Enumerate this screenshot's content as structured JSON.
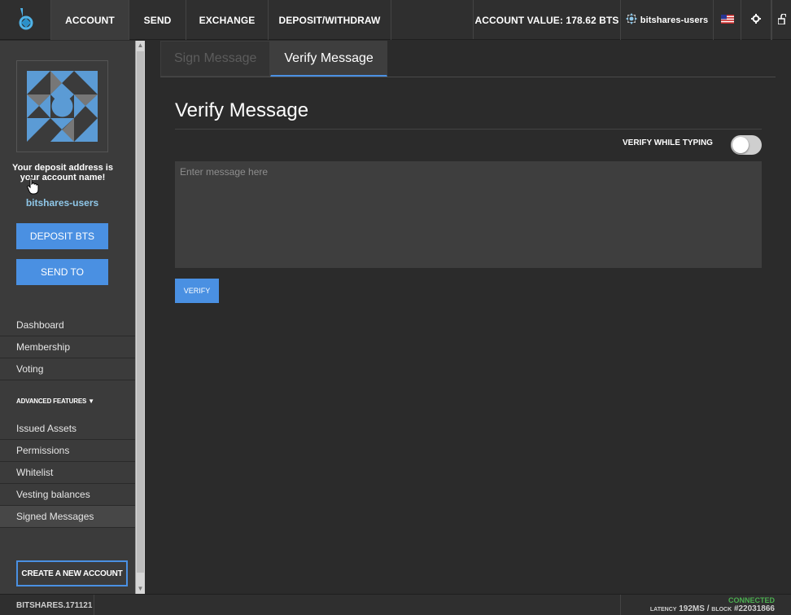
{
  "topbar": {
    "nav": {
      "account": "ACCOUNT",
      "send": "SEND",
      "exchange": "EXCHANGE",
      "deposit_withdraw": "DEPOSIT/WITHDRAW"
    },
    "account_value": "ACCOUNT VALUE: 178.62 BTS",
    "account_name": "bitshares-users",
    "icons": {
      "logo": "bitshares-logo-icon",
      "account": "account-identicon-icon",
      "flag": "us-flag-icon",
      "settings": "gear-icon",
      "lock": "unlock-icon"
    }
  },
  "sidebar": {
    "deposit_note": "Your deposit address is your account name!",
    "account_name": "bitshares-users",
    "deposit_button": "DEPOSIT BTS",
    "send_button": "SEND TO",
    "menu": [
      "Dashboard",
      "Membership",
      "Voting"
    ],
    "advanced_label": "ADVANCED FEATURES ▼",
    "advanced_menu": [
      "Issued Assets",
      "Permissions",
      "Whitelist",
      "Vesting balances",
      "Signed Messages"
    ],
    "active_item": "Signed Messages",
    "create_account": "CREATE A NEW ACCOUNT"
  },
  "main": {
    "tabs": [
      {
        "label": "Sign Message",
        "selected": false
      },
      {
        "label": "Verify Message",
        "selected": true
      }
    ],
    "title": "Verify Message",
    "verify_while_typing_label": "VERIFY WHILE TYPING",
    "verify_while_typing_on": false,
    "message_placeholder": "Enter message here",
    "verify_button": "VERIFY"
  },
  "footer": {
    "version": "BITSHARES.171121",
    "status": "CONNECTED",
    "latency_label": "LATENCY",
    "latency_value": "192MS",
    "block_label": "BLOCK",
    "block_value": "#22031866"
  },
  "colors": {
    "accent": "#4a90e2",
    "connected": "#4caf50",
    "account_link": "#8fc7e8"
  }
}
